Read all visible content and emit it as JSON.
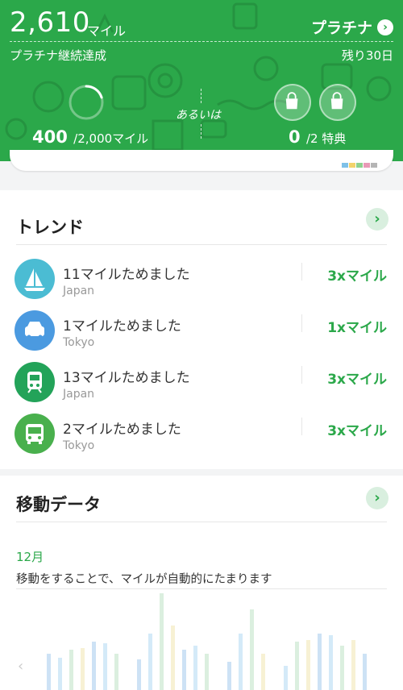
{
  "header": {
    "miles_value": "2,610",
    "miles_unit": "マイル",
    "tier_label": "プラチナ",
    "status_left": "プラチナ継続達成",
    "status_right": "残り30日",
    "progress_current": "400",
    "progress_total": "/2,000マイル",
    "progress_fraction": 0.2,
    "or_label": "あるいは",
    "benefit_current": "0",
    "benefit_total": "/2 特典"
  },
  "trend": {
    "title": "トレンド",
    "items": [
      {
        "title": "11マイルためました",
        "sub": "Japan",
        "mult": "3xマイル",
        "icon": "sailboat-icon",
        "color": "#4bbcd3"
      },
      {
        "title": "1マイルためました",
        "sub": "Tokyo",
        "mult": "1xマイル",
        "icon": "car-icon",
        "color": "#4b9ae0"
      },
      {
        "title": "13マイルためました",
        "sub": "Japan",
        "mult": "3xマイル",
        "icon": "train-icon",
        "color": "#23a359"
      },
      {
        "title": "2マイルためました",
        "sub": "Tokyo",
        "mult": "3xマイル",
        "icon": "bus-icon",
        "color": "#49b04d"
      }
    ]
  },
  "movement": {
    "title": "移動データ",
    "month": "12月",
    "description": "移動をすることで、マイルが自動的にたまります"
  },
  "colors": {
    "brand_green": "#2ba84a",
    "accent_light_green": "#d9efdf"
  }
}
